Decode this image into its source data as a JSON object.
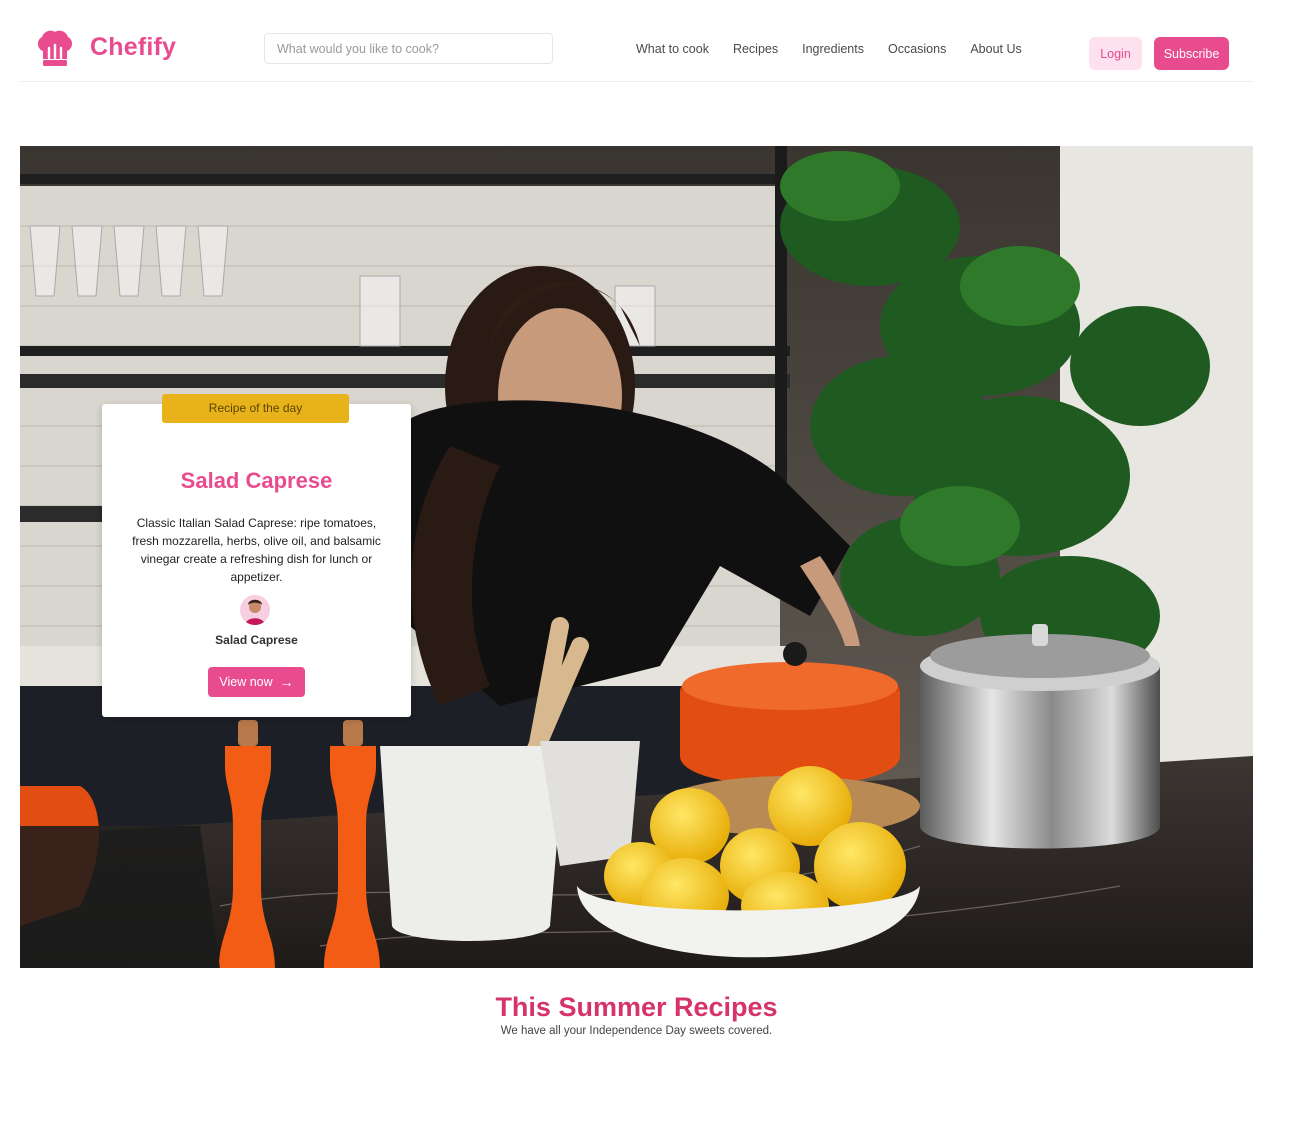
{
  "brand": {
    "name": "Chefify",
    "logo_icon": "chef-hat-icon",
    "accent_color": "#e94b8f"
  },
  "search": {
    "placeholder": "What would you like to cook?"
  },
  "nav": {
    "items": [
      {
        "label": "What to cook"
      },
      {
        "label": "Recipes"
      },
      {
        "label": "Ingredients"
      },
      {
        "label": "Occasions"
      },
      {
        "label": "About Us"
      }
    ]
  },
  "auth": {
    "login_label": "Login",
    "subscribe_label": "Subscribe"
  },
  "hero": {
    "badge": "Recipe of the day",
    "title": "Salad Caprese",
    "description": "Classic Italian Salad Caprese: ripe tomatoes, fresh mozzarella, herbs, olive oil, and balsamic vinegar create a refreshing dish for lunch or appetizer.",
    "author": "Salad Caprese",
    "cta_label": "View now",
    "cta_icon": "arrow-right-icon",
    "badge_color": "#e8b21a"
  },
  "section": {
    "title": "This Summer Recipes",
    "subtitle": "We have all your Independence Day sweets covered."
  }
}
